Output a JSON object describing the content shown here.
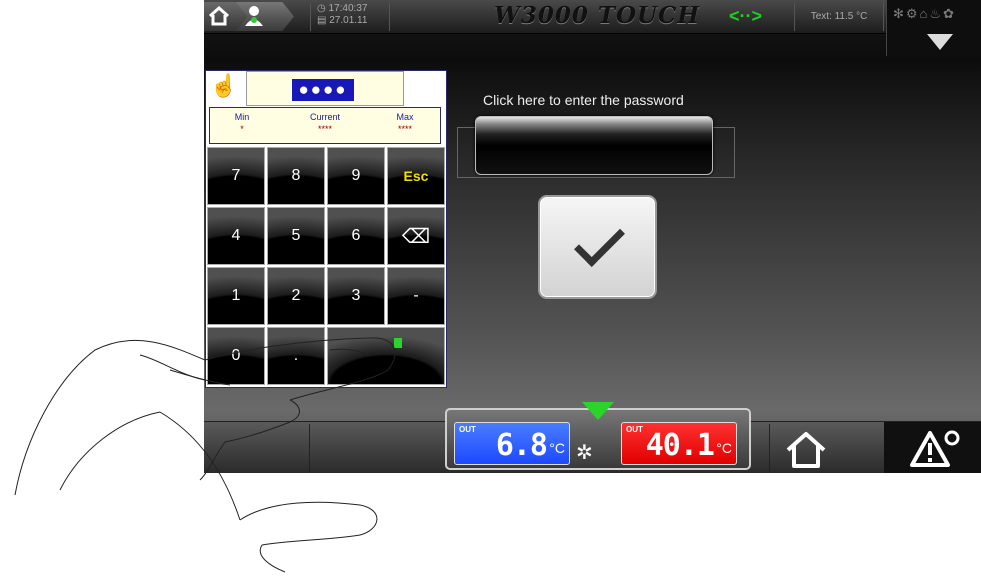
{
  "topbar": {
    "time": "17:40:37",
    "date": "27.01.11",
    "title": "W3000 TOUCH",
    "text_temp": "Text: 11.5 °C"
  },
  "keypad": {
    "password_mask": "●●●●",
    "limits": {
      "min_label": "Min",
      "min_value": "*",
      "current_label": "Current",
      "current_value": "****",
      "max_label": "Max",
      "max_value": "****"
    },
    "keys": [
      "7",
      "8",
      "9",
      "Esc",
      "4",
      "5",
      "6",
      "⌫",
      "1",
      "2",
      "3",
      "-",
      "0",
      ".",
      "",
      ""
    ]
  },
  "password": {
    "prompt": "Click here to enter the password"
  },
  "status": {
    "temp1_tag": "OUT",
    "temp1_value": "6.8",
    "temp1_unit": "°C",
    "temp2_tag": "OUT",
    "temp2_value": "40.1",
    "temp2_unit": "°C",
    "alarm_count": "0"
  },
  "colors": {
    "temp1_bg": "#1d49ff",
    "temp2_bg": "#e00000",
    "indicator_green": "#2ad42a",
    "esc_yellow": "#f0e000"
  }
}
